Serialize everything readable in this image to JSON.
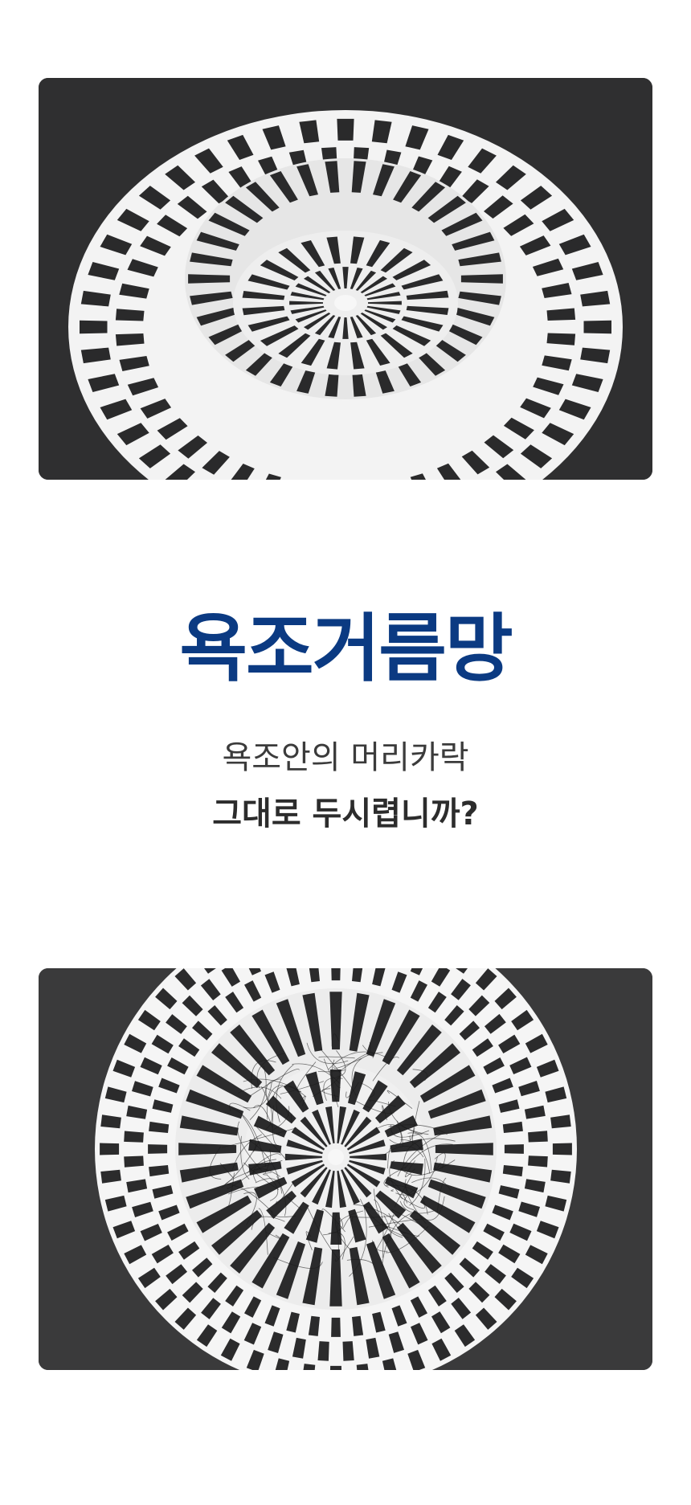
{
  "photos": {
    "top": {
      "icon": "drain-strainer-icon",
      "colors": {
        "background": "#2f2f30",
        "strainer": "#f3f3f3",
        "slots": "#2a2a2b"
      }
    },
    "bottom": {
      "icon": "drain-strainer-with-hair-icon",
      "colors": {
        "background": "#3a3a3b",
        "strainer": "#f5f5f5",
        "slots": "#2b2b2c",
        "hair": "#1a1a1a"
      }
    }
  },
  "heading": {
    "title": "욕조거름망",
    "title_color": "#0b3a82",
    "line1": "욕조안의 머리카락",
    "line2": "그대로 두시렵니까?"
  }
}
